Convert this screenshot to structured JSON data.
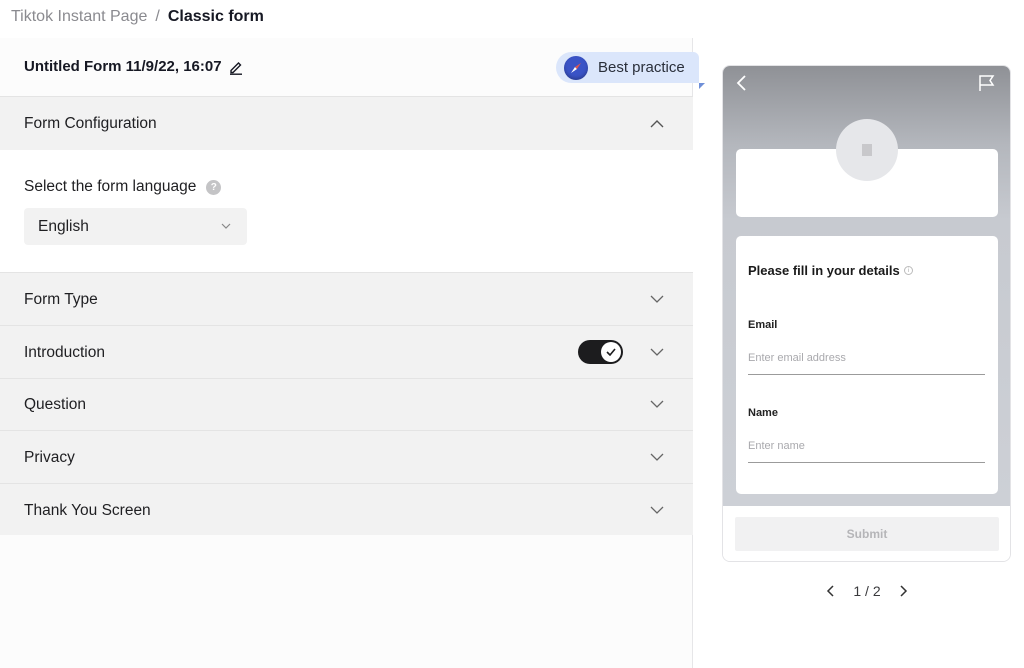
{
  "breadcrumb": {
    "parent": "Tiktok Instant Page",
    "separator": "/",
    "current": "Classic form"
  },
  "editor": {
    "form_title": "Untitled Form 11/9/22, 16:07",
    "best_practice_label": "Best practice",
    "sections": [
      {
        "label": "Form Configuration",
        "expanded": true
      },
      {
        "label": "Form Type",
        "expanded": false
      },
      {
        "label": "Introduction",
        "expanded": false,
        "toggle_on": true
      },
      {
        "label": "Question",
        "expanded": false
      },
      {
        "label": "Privacy",
        "expanded": false
      },
      {
        "label": "Thank You Screen",
        "expanded": false
      }
    ],
    "config": {
      "language_label": "Select the form language",
      "help_glyph": "?",
      "language_value": "English"
    }
  },
  "preview": {
    "form_heading": "Please fill in your details",
    "info_glyph": "i",
    "fields": [
      {
        "label": "Email",
        "placeholder": "Enter email address"
      },
      {
        "label": "Name",
        "placeholder": "Enter name"
      }
    ],
    "submit_label": "Submit",
    "pager": {
      "text": "1 / 2",
      "current": 1,
      "total": 2
    }
  },
  "colors": {
    "accent_blue": "#3a53c6",
    "best_practice_bg": "#dbe6fb",
    "toggle_on": "#1c1c1e"
  }
}
